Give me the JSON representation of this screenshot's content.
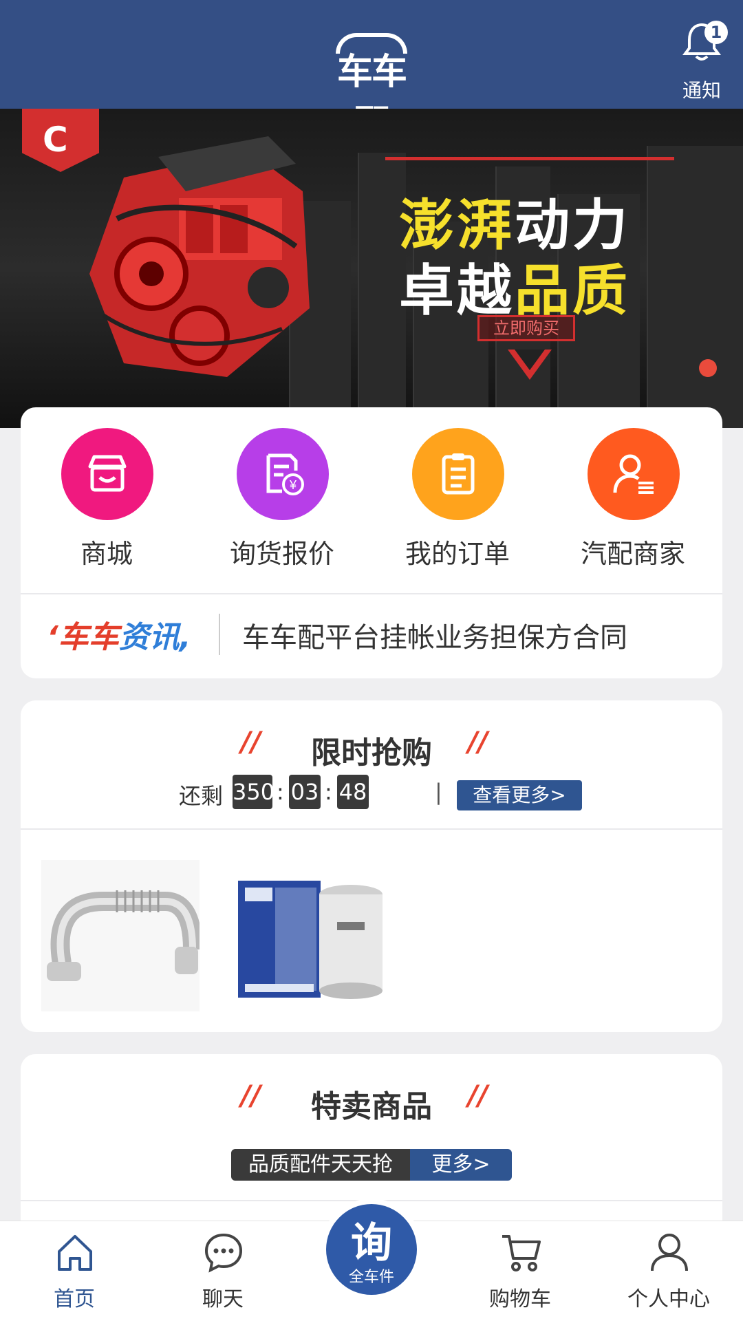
{
  "header": {
    "logo_text": "车车配",
    "notice_label": "通知",
    "notice_count": "1"
  },
  "banner": {
    "slogan_line1_a": "澎湃",
    "slogan_line1_b": "动力",
    "slogan_line2_a": "卓越",
    "slogan_line2_b": "品质",
    "buy_label": "立即购买",
    "colors": {
      "accent_red": "#d32f2f",
      "yellow": "#f6e02c"
    }
  },
  "menu": {
    "items": [
      {
        "label": "商城",
        "icon": "shop-icon",
        "color": "#f0197f"
      },
      {
        "label": "询货报价",
        "icon": "quote-document-icon",
        "color": "#b73ee8"
      },
      {
        "label": "我的订单",
        "icon": "order-list-icon",
        "color": "#ffa31c"
      },
      {
        "label": "汽配商家",
        "icon": "merchant-user-icon",
        "color": "#ff5a1f"
      }
    ]
  },
  "news": {
    "tag_red": "‘车车",
    "tag_blue": "资讯,",
    "headline": "车车配平台挂帐业务担保方合同"
  },
  "flash_sale": {
    "title": "限时抢购",
    "remaining_label": "还剩",
    "hours": "350",
    "minutes": "03",
    "seconds": "48",
    "separator": "|",
    "more_label": "查看更多>",
    "products": [
      {
        "name": "egr-pipe-image"
      },
      {
        "name": "oil-filter-image"
      }
    ]
  },
  "special": {
    "title": "特卖商品",
    "slogan": "品质配件天天抢",
    "more_label": "更多>"
  },
  "tabbar": {
    "items": [
      {
        "label": "首页",
        "icon": "home-icon",
        "active": true
      },
      {
        "label": "聊天",
        "icon": "chat-icon",
        "active": false
      },
      {
        "label": "购物车",
        "icon": "cart-icon",
        "active": false
      },
      {
        "label": "个人中心",
        "icon": "user-icon",
        "active": false
      }
    ],
    "center_big": "询",
    "center_small": "全车件",
    "active_color": "#2f5591"
  }
}
